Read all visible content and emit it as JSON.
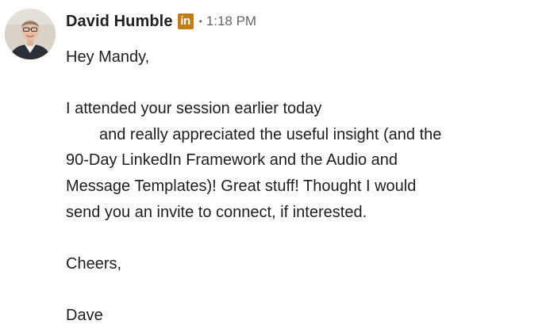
{
  "message": {
    "sender": {
      "name": "David Humble",
      "badge_icon": "linkedin-premium-icon",
      "badge_text": "in",
      "badge_color": "#c37d16",
      "separator": "•",
      "timestamp": "1:18 PM"
    },
    "body": {
      "greeting": "Hey Mandy,",
      "paragraph_lines": [
        "I attended your session earlier today",
        "and really appreciated the useful insight (and the",
        "90-Day LinkedIn Framework and the Audio and",
        "Message Templates)! Great stuff! Thought I would",
        "send you an invite to connect, if interested."
      ],
      "closing": "Cheers,",
      "signature": "Dave"
    }
  }
}
